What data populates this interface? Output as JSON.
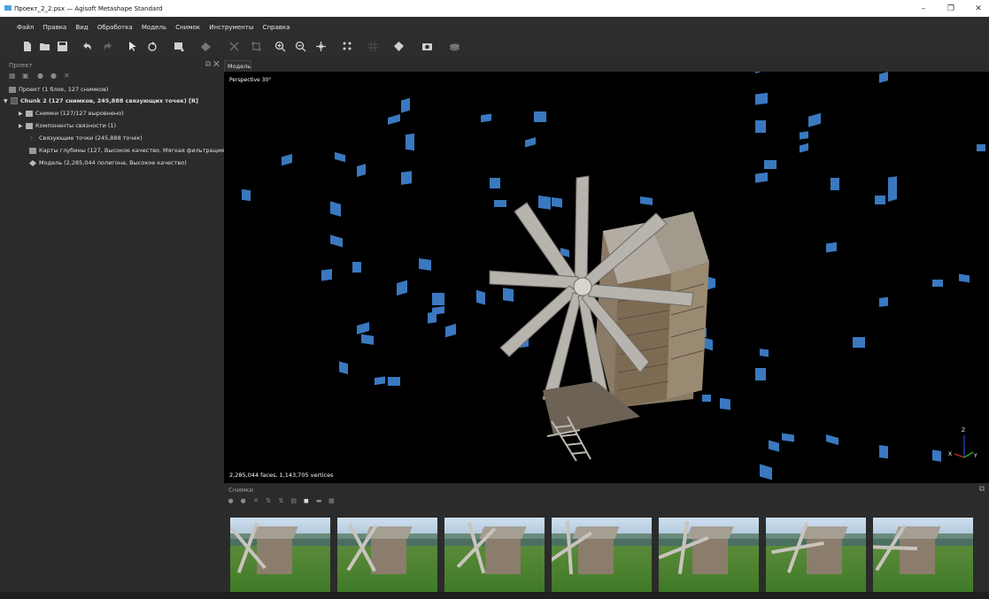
{
  "window": {
    "title": "Проект_2_2.psx — Agisoft Metashape Standard",
    "min_glyph": "–",
    "max_glyph": "❐",
    "close_glyph": "✕"
  },
  "menu": [
    "Файл",
    "Правка",
    "Вид",
    "Обработка",
    "Модель",
    "Снимок",
    "Инструменты",
    "Справка"
  ],
  "toolbar_icons": [
    "new-icon",
    "open-icon",
    "save-icon",
    "undo-icon",
    "redo-icon",
    "select-icon",
    "rotate-icon",
    "selection-mode-icon",
    "shape-icon",
    "delete-icon",
    "crop-icon",
    "zoom-in-icon",
    "zoom-out-icon",
    "move-icon",
    "points-icon",
    "grid-icon",
    "model-view-icon",
    "camera-icon",
    "layers-icon"
  ],
  "project_panel": {
    "title": "Проект",
    "float_glyph": "⧉",
    "close_glyph": "✕",
    "tree": {
      "root": "Проект (1 блок, 127 снимков)",
      "chunk": "Chunk 2 (127 снимков, 245,888 связующих точек) [R]",
      "photos": "Снимки (127/127 выровнено)",
      "components": "Компоненты связности (1)",
      "tie_points": "Связующие точки (245,888 точек)",
      "depth_maps": "Карты глубины (127, Высокое качество, Мягкая фильтрация)",
      "model": "Модель (2,285,044 полигона, Высокое качество)"
    }
  },
  "model_tab": {
    "label": "Модель",
    "perspective": "Perspective 30°",
    "stats": "2,285,044 faces, 1,143,705 vertices",
    "axis_labels": {
      "x": "X",
      "y": "Y",
      "z": "Z"
    }
  },
  "photos_panel": {
    "title": "Снимки",
    "float_glyph": "⧉",
    "thumbnail_count": 7
  },
  "colors": {
    "camera_blue": "#3a78c0",
    "background": "#2b2b2b",
    "viewport": "#000000"
  }
}
